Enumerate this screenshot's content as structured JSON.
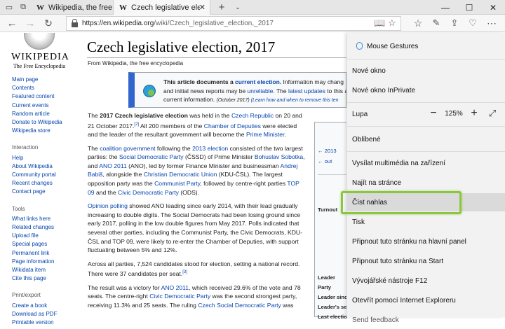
{
  "tabs": [
    {
      "title": "Wikipedia, the free encyclop",
      "favicon": "W",
      "active": false
    },
    {
      "title": "Czech legislative electio",
      "favicon": "W",
      "active": true
    }
  ],
  "address": {
    "host": "https://en.wikipedia.org",
    "path": "/wiki/Czech_legislative_election,_2017"
  },
  "wiki": {
    "wordmark": "Wikipedia",
    "tagline": "The Free Encyclopedia",
    "nav_main": [
      "Main page",
      "Contents",
      "Featured content",
      "Current events",
      "Random article",
      "Donate to Wikipedia",
      "Wikipedia store"
    ],
    "nav_interaction_heading": "Interaction",
    "nav_interaction": [
      "Help",
      "About Wikipedia",
      "Community portal",
      "Recent changes",
      "Contact page"
    ],
    "nav_tools_heading": "Tools",
    "nav_tools": [
      "What links here",
      "Related changes",
      "Upload file",
      "Special pages",
      "Permanent link",
      "Page information",
      "Wikidata item",
      "Cite this page"
    ],
    "nav_print_heading": "Print/export",
    "nav_print": [
      "Create a book",
      "Download as PDF",
      "Printable version"
    ],
    "title": "Czech legislative election, 2017",
    "from": "From Wikipedia, the free encyclopedia",
    "notice": {
      "line1_a": "This article documents a ",
      "line1_link": "current election.",
      "line1_b": " Information may chang",
      "line2_a": "and initial news reports may be ",
      "line2_link1": "unreliable",
      "line2_b": ". The ",
      "line2_link2": "latest updates",
      "line2_c": " to this a",
      "line3_a": "current information. ",
      "line3_small": "(October 2017) ",
      "line3_link": "(Learn how and when to remove this ten"
    },
    "infobox": {
      "prev": "← 2013",
      "outgoing": "← out",
      "rows": [
        "Turnout",
        "Leader",
        "Party",
        "Leader sinc",
        "Leader's se",
        "Last electio"
      ]
    }
  },
  "menu": {
    "header": "Mouse Gestures",
    "items": [
      "Nové okno",
      "Nové okno InPrivate"
    ],
    "zoom_label": "Lupa",
    "zoom_value": "125%",
    "items2": [
      "Oblíbené"
    ],
    "items3": [
      "Vysílat multimédia na zařízení",
      "Najít na stránce",
      "Číst nahlas",
      "Tisk",
      "Připnout tuto stránku na hlavní panel",
      "Připnout tuto stránku na Start",
      "Vývojářské nástroje F12",
      "Otevřít pomocí Internet Exploreru",
      "Send feedback"
    ],
    "selected": "Číst nahlas"
  }
}
